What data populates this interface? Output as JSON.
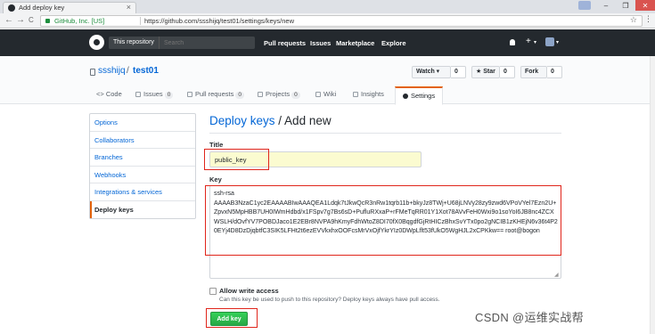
{
  "browser": {
    "tab_title": "Add deploy key",
    "tab_close": "×",
    "win_min": "–",
    "win_max": "❐",
    "win_close": "✕",
    "back": "←",
    "forward": "→",
    "reload": "C",
    "secure_label": "GitHub, Inc. [US]",
    "url": "https://github.com/ssshijq/test01/settings/keys/new",
    "star": "☆",
    "menu": "⋮"
  },
  "header": {
    "scope": "This repository",
    "search_placeholder": "Search",
    "nav": [
      "Pull requests",
      "Issues",
      "Marketplace",
      "Explore"
    ],
    "plus": "+",
    "caret": "▾"
  },
  "repo": {
    "owner": "ssshijq",
    "slash": "/",
    "name": "test01",
    "watch_label": "Watch ▾",
    "watch_count": "0",
    "star_label": "★ Star",
    "star_count": "0",
    "fork_label": "Fork",
    "fork_count": "0"
  },
  "reponav": {
    "code": "<> Code",
    "issues": "Issues",
    "issues_count": "0",
    "pulls": "Pull requests",
    "pulls_count": "0",
    "projects": "Projects",
    "projects_count": "0",
    "wiki": "Wiki",
    "insights": "Insights",
    "settings": "Settings"
  },
  "sidebar": {
    "items": [
      "Options",
      "Collaborators",
      "Branches",
      "Webhooks",
      "Integrations & services",
      "Deploy keys"
    ]
  },
  "form": {
    "crumb_link": "Deploy keys",
    "crumb_rest": " / Add new",
    "title_label": "Title",
    "title_value": "public_key",
    "key_label": "Key",
    "key_value": "ssh-rsa\nAAAAB3NzaC1yc2EAAAABIwAAAQEA1Ldqk7tJkwQcR3nRw1tqrb11b+bkyJz8TWj+U68jLNVy28zy9zwd6VPoVYel7Ezn2U+ZpvxN5MpHBB7UH0IWmHdbd/x1FSpv7g7Bs6sD+PufluRXxaP+rFMeTqRR01Y1Xot78AVvFeH0Wxi9o1soYoI6JB8nc4ZCXWSLH/dOvfYV7POBDJaco1E2EBr8NVPA9hKmyFdhWtoZ8DI70fX0BqgdfGjRtHICzBhxSvYTx0po2gNCIB1zKHEjN6v36t4P20EYj4D8DzDjqbtfC3SIK5LFHt2t6ezEVVkxhxOOFcsMrVxOjfYkrYIz0DWpLflt53fUkO5WgHJL2xCPKkw== root@bogon",
    "allow_write_label": "Allow write access",
    "allow_write_note": "Can this key be used to push to this repository? Deploy keys always have pull access.",
    "submit_label": "Add key"
  },
  "watermark": "CSDN @运维实战帮"
}
